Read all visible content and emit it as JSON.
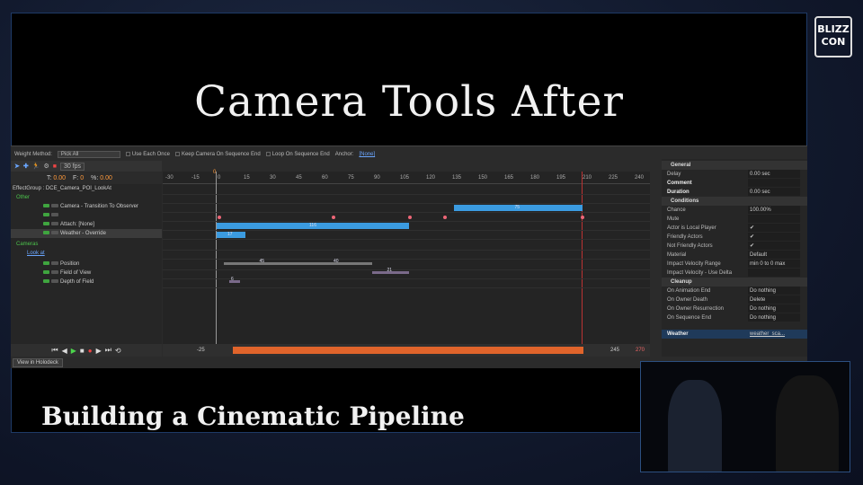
{
  "slide": {
    "title": "Camera Tools After",
    "subtitle": "Building a Cinematic Pipeline",
    "logo_text": "BLIZZ CON"
  },
  "editor": {
    "options": {
      "weight_method_label": "Weight Method:",
      "weight_method_value": "Pick All",
      "use_each_once": "Use Each Once",
      "keep_camera": "Keep Camera On Sequence End",
      "loop_on_end": "Loop On Sequence End",
      "actor_label": "Anchor:",
      "actor_value": "[None]"
    },
    "toolbar": {
      "fps": "30 fps"
    },
    "time": {
      "t_label": "T:",
      "t_value": "0.00",
      "f_label": "F:",
      "f_value": "0",
      "pct_label": "%:",
      "pct_value": "0.00"
    },
    "tree": [
      {
        "label": "EffectGroup : DCE_Camera_POI_LookAt",
        "indent": 2,
        "kind": "root"
      },
      {
        "label": "Other",
        "indent": 6,
        "kind": "group"
      },
      {
        "label": "Camera - Transition To Observer",
        "indent": 36,
        "kind": "item"
      },
      {
        "label": "",
        "indent": 36,
        "kind": "item"
      },
      {
        "label": "Attach: [None]",
        "indent": 36,
        "kind": "attach"
      },
      {
        "label": "Weather - Override",
        "indent": 36,
        "kind": "item",
        "selected": true
      },
      {
        "label": "Cameras",
        "indent": 6,
        "kind": "group"
      },
      {
        "label": "Look at",
        "indent": 18,
        "kind": "link"
      },
      {
        "label": "Position",
        "indent": 36,
        "kind": "item"
      },
      {
        "label": "Field of View",
        "indent": 36,
        "kind": "item"
      },
      {
        "label": "Depth of Field",
        "indent": 36,
        "kind": "item"
      }
    ],
    "ruler_ticks": [
      "-30",
      "-15",
      "0",
      "15",
      "30",
      "45",
      "60",
      "75",
      "90",
      "105",
      "120",
      "135",
      "150",
      "165",
      "180",
      "195",
      "210",
      "225",
      "240"
    ],
    "current_frame": "0",
    "bars": [
      {
        "label": "75",
        "color": "blue"
      },
      {
        "label": "116",
        "color": "blue"
      },
      {
        "label": "17",
        "color": "blue"
      },
      {
        "label": "45",
        "color": "grey"
      },
      {
        "label": "40",
        "color": "grey"
      },
      {
        "label": "21",
        "color": "purple"
      },
      {
        "label": "6",
        "color": "purple"
      }
    ],
    "range": {
      "start": "-25",
      "end_a": "245",
      "end_b": "270"
    },
    "view_button": "View in Holodeck",
    "properties": {
      "general_header": "General",
      "general": [
        {
          "key": "Delay",
          "value": "0.00 sec"
        },
        {
          "key": "Comment",
          "value": ""
        },
        {
          "key": "Duration",
          "value": "0.00 sec"
        }
      ],
      "conditions_header": "Conditions",
      "conditions": [
        {
          "key": "Chance",
          "value": "100.00%"
        },
        {
          "key": "Mute",
          "value": ""
        },
        {
          "key": "Actor is Local Player",
          "value": "✔"
        },
        {
          "key": "Friendly Actors",
          "value": "✔"
        },
        {
          "key": "Not Friendly Actors",
          "value": "✔"
        },
        {
          "key": "Material",
          "value": "Default"
        },
        {
          "key": "Impact Velocity Range",
          "value": "min 0  to  0  max"
        },
        {
          "key": "Impact Velocity - Use Delta",
          "value": ""
        }
      ],
      "cleanup_header": "Cleanup",
      "cleanup": [
        {
          "key": "On Animation End",
          "value": "Do nothing"
        },
        {
          "key": "On Owner Death",
          "value": "Delete"
        },
        {
          "key": "On Owner Resurrection",
          "value": "Do nothing"
        },
        {
          "key": "On Sequence End",
          "value": "Do nothing"
        }
      ],
      "weather_key": "Weather",
      "weather_value": "weather_sca..."
    }
  },
  "colors": {
    "accent": "#3b9be0",
    "range": "#e0642b",
    "endline": "#b33333",
    "group_green": "#4cc34c"
  }
}
